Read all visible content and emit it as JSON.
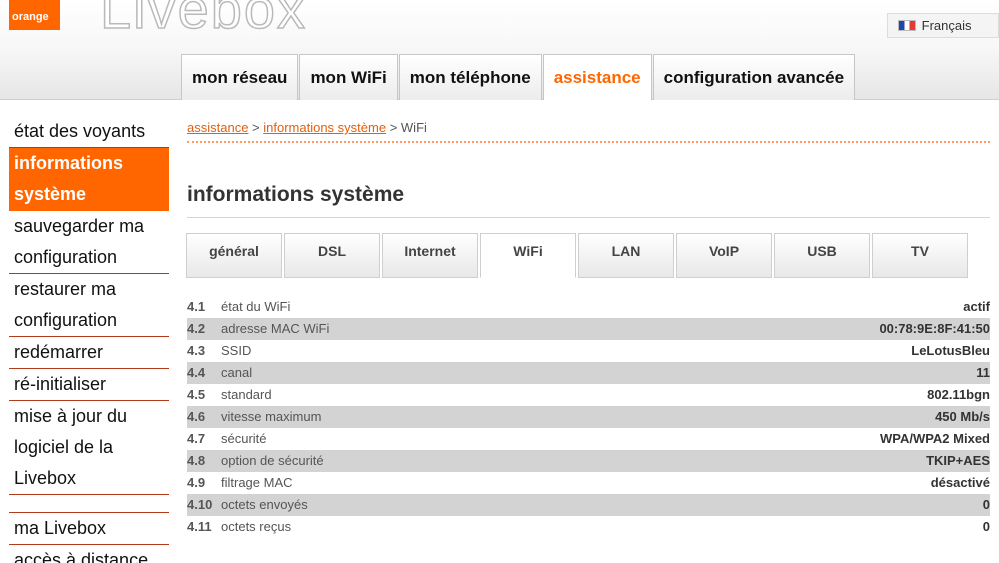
{
  "header": {
    "logo_text": "orange",
    "brand": "Livebox",
    "language": "Français",
    "flag_icon": "french-flag-icon"
  },
  "nav": {
    "tabs": [
      {
        "label": "mon réseau"
      },
      {
        "label": "mon WiFi"
      },
      {
        "label": "mon téléphone"
      },
      {
        "label": "assistance",
        "active": true
      },
      {
        "label": "configuration avancée"
      }
    ]
  },
  "sidebar": {
    "items": [
      {
        "label": "état des voyants"
      },
      {
        "label": "informations système",
        "active": true
      },
      {
        "label": "sauvegarder ma configuration"
      },
      {
        "label": "restaurer ma configuration"
      },
      {
        "label": "redémarrer"
      },
      {
        "label": "ré-initialiser"
      },
      {
        "label": "mise à jour du logiciel de la Livebox"
      },
      {
        "label": "ma Livebox"
      },
      {
        "label": "accès à distance"
      }
    ]
  },
  "breadcrumb": {
    "part1": "assistance",
    "sep1": " > ",
    "part2": "informations système",
    "sep2": " > ",
    "current": "WiFi"
  },
  "page_title": "informations système",
  "subtabs": [
    {
      "label": "général"
    },
    {
      "label": "DSL"
    },
    {
      "label": "Internet"
    },
    {
      "label": "WiFi",
      "active": true
    },
    {
      "label": "LAN"
    },
    {
      "label": "VoIP"
    },
    {
      "label": "USB"
    },
    {
      "label": "TV"
    }
  ],
  "info_rows": [
    {
      "num": "4.1",
      "label": "état du WiFi",
      "value": "actif"
    },
    {
      "num": "4.2",
      "label": "adresse MAC WiFi",
      "value": "00:78:9E:8F:41:50"
    },
    {
      "num": "4.3",
      "label": "SSID",
      "value": "LeLotusBleu"
    },
    {
      "num": "4.4",
      "label": "canal",
      "value": "11"
    },
    {
      "num": "4.5",
      "label": "standard",
      "value": "802.11bgn"
    },
    {
      "num": "4.6",
      "label": "vitesse maximum",
      "value": "450 Mb/s"
    },
    {
      "num": "4.7",
      "label": "sécurité",
      "value": "WPA/WPA2 Mixed"
    },
    {
      "num": "4.8",
      "label": "option de sécurité",
      "value": "TKIP+AES"
    },
    {
      "num": "4.9",
      "label": "filtrage MAC",
      "value": "désactivé"
    },
    {
      "num": "4.10",
      "label": "octets envoyés",
      "value": "0"
    },
    {
      "num": "4.11",
      "label": "octets reçus",
      "value": "0"
    }
  ],
  "colors": {
    "accent": "#ff6600",
    "row_alt": "#d3d3d3"
  }
}
